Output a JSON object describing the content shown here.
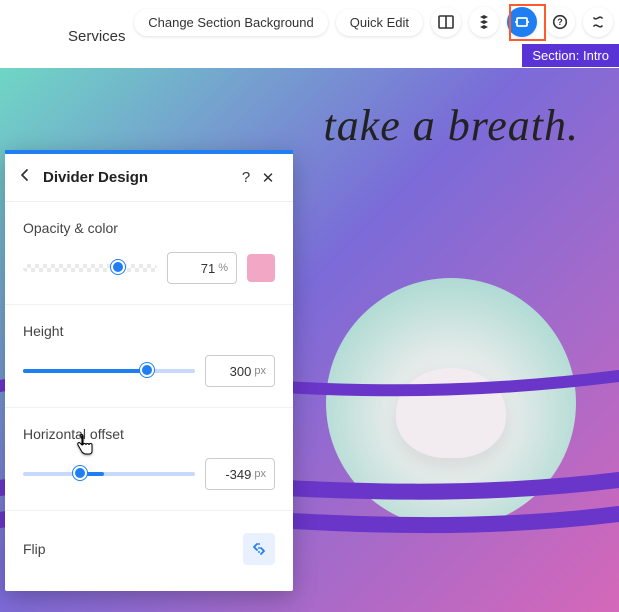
{
  "nav": {
    "services_label": "Services"
  },
  "toolbar": {
    "change_bg_label": "Change Section Background",
    "quick_edit_label": "Quick Edit",
    "panel_icon": "panel-layout-icon",
    "stack_icon": "layers-icon",
    "stretch_icon": "stretch-icon",
    "help_icon": "help-icon",
    "more_icon": "more-icon"
  },
  "section_tag": "Section: Intro",
  "hero": {
    "text": "take a breath."
  },
  "panel": {
    "title": "Divider Design",
    "back": "‹",
    "help": "?",
    "close": "✕",
    "opacity": {
      "label": "Opacity & color",
      "value": "71",
      "unit": "%",
      "percent": 71,
      "swatch": "#f2a8c5"
    },
    "height": {
      "label": "Height",
      "value": "300",
      "unit": "px",
      "percent": 72
    },
    "hoffset": {
      "label": "Horizontal offset",
      "value": "-349",
      "unit": "px",
      "percent_start": 33,
      "percent_end": 47
    },
    "flip": {
      "label": "Flip"
    }
  }
}
